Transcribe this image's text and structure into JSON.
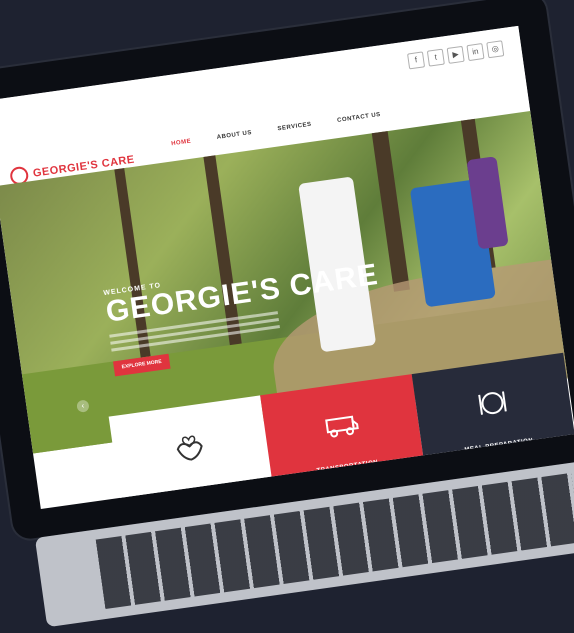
{
  "site": {
    "brand": "GEORGIE'S CARE",
    "nav": [
      {
        "label": "HOME",
        "active": true
      },
      {
        "label": "ABOUT US",
        "active": false
      },
      {
        "label": "SERVICES",
        "active": false
      },
      {
        "label": "CONTACT US",
        "active": false
      }
    ],
    "social_icons": [
      "facebook-icon",
      "twitter-icon",
      "youtube-icon",
      "linkedin-icon",
      "instagram-icon"
    ],
    "hero": {
      "welcome": "WELCOME TO",
      "title": "GEORGIE'S CARE",
      "cta": "EXPLORE MORE"
    },
    "services": [
      {
        "label": "",
        "icon": "care-hands-icon",
        "style": "white"
      },
      {
        "label": "TRANSPORTATION",
        "icon": "van-icon",
        "style": "red"
      },
      {
        "label": "MEAL PREPARATION",
        "icon": "meal-icon",
        "style": "dark"
      }
    ],
    "colors": {
      "accent": "#e0343e",
      "dark": "#272b3a",
      "bezel": "#0c0e14",
      "background": "#1e2230"
    }
  }
}
